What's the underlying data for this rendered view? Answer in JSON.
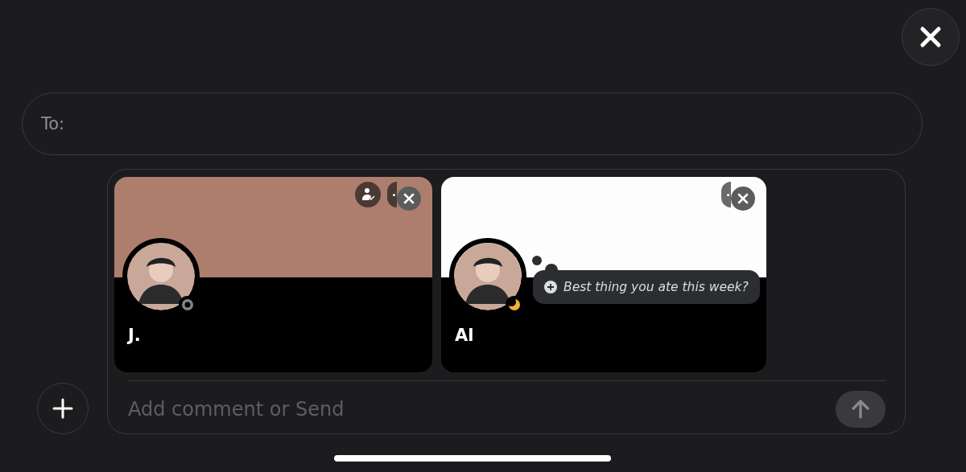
{
  "to_field": {
    "label": "To:"
  },
  "cards": [
    {
      "name": "J.",
      "color": "#ad7e6e",
      "kind": "ring",
      "friend_badge": true
    },
    {
      "name": "Al",
      "color": "#fdfdfd",
      "kind": "moon",
      "friend_badge": false,
      "prompt": "Best thing you ate this week?"
    }
  ],
  "composer": {
    "placeholder": "Add comment or Send"
  }
}
